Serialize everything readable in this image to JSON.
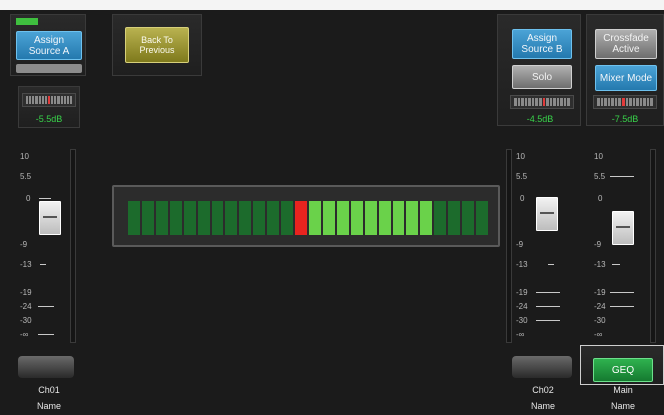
{
  "buttons": {
    "assign_source_a": "Assign Source A",
    "back_to_previous": "Back To Previous",
    "assign_source_b": "Assign Source B",
    "crossfade_active": "Crossfade Active",
    "solo": "Solo",
    "mixer_mode": "Mixer Mode",
    "geq": "GEQ"
  },
  "channels": [
    {
      "gain": "-5.5dB",
      "label": "Ch01",
      "name": "Name"
    },
    {
      "gain": "-4.5dB",
      "label": "Ch02",
      "name": "Name"
    },
    {
      "gain": "-7.5dB",
      "label": "Main",
      "name": "Name"
    }
  ],
  "fader_scale": [
    "10",
    "5.5",
    "0",
    "-9",
    "-13",
    "-19",
    "-24",
    "-30",
    "-∞"
  ],
  "level_meter": {
    "segments": 26,
    "red_index": 12,
    "colors": {
      "dark_green": "#1c6b2c",
      "light_green": "#6ad24a",
      "red": "#e8241f"
    }
  },
  "colors": {
    "accent_blue": "#2f8cc4",
    "olive": "#a29b38",
    "geq_green": "#22a045"
  }
}
